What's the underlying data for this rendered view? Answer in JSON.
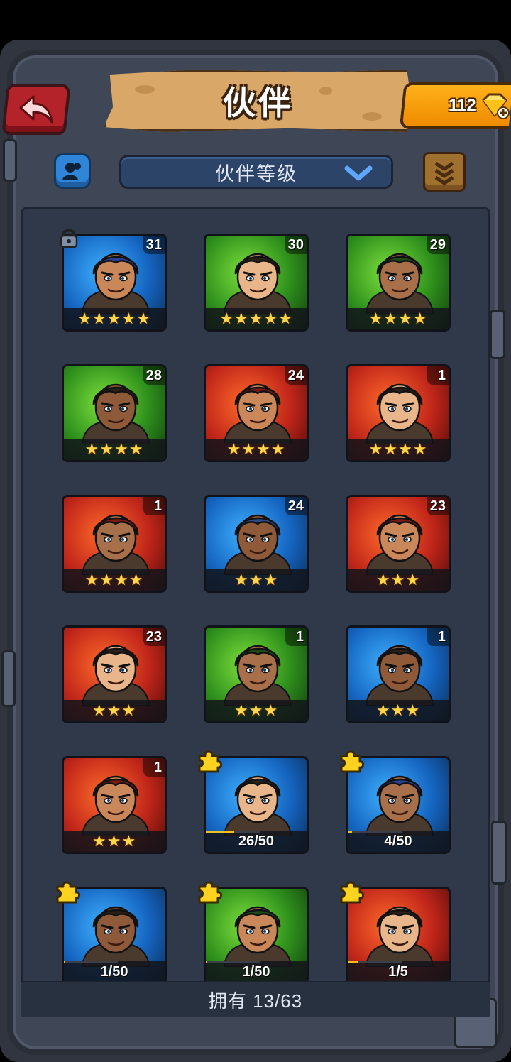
{
  "header": {
    "title": "伙伴",
    "gems": "112"
  },
  "toolbar": {
    "sort_label": "伙伴等级"
  },
  "footer": {
    "owned_label": "拥有 13/63"
  },
  "colors": {
    "blue": "#2a8fe3",
    "green": "#3fa42a",
    "red": "#cf2a1c",
    "gold_star": "#ffd54a"
  },
  "heroes": [
    {
      "level": "31",
      "stars": "★★★★★",
      "glow": "blue",
      "locked": true,
      "icon": "bearded-warrior-portrait"
    },
    {
      "level": "30",
      "stars": "★★★★★",
      "glow": "green",
      "icon": "hooded-elf-portrait"
    },
    {
      "level": "29",
      "stars": "★★★★",
      "glow": "green",
      "icon": "dark-haired-woman-portrait"
    },
    {
      "level": "28",
      "stars": "★★★★",
      "glow": "green",
      "icon": "long-haired-man-portrait"
    },
    {
      "level": "24",
      "stars": "★★★★",
      "glow": "red",
      "icon": "scarecrow-hat-portrait"
    },
    {
      "level": "1",
      "stars": "★★★★",
      "glow": "red",
      "icon": "lizard-red-cap-portrait"
    },
    {
      "level": "1",
      "stars": "★★★★",
      "glow": "red",
      "icon": "afro-headband-woman-portrait"
    },
    {
      "level": "24",
      "stars": "★★★",
      "glow": "blue",
      "icon": "boar-beast-portrait"
    },
    {
      "level": "23",
      "stars": "★★★",
      "glow": "red",
      "icon": "blonde-woman-skull-portrait"
    },
    {
      "level": "23",
      "stars": "★★★",
      "glow": "red",
      "icon": "werewolf-portrait"
    },
    {
      "level": "1",
      "stars": "★★★",
      "glow": "green",
      "icon": "green-haired-man-portrait"
    },
    {
      "level": "1",
      "stars": "★★★",
      "glow": "blue",
      "icon": "blue-lizard-portrait"
    },
    {
      "level": "1",
      "stars": "★★★",
      "glow": "red",
      "icon": "red-beast-portrait"
    },
    {
      "progress": "26/50",
      "fraction": 0.52,
      "glow": "blue",
      "shard": true,
      "icon": "armored-beast-portrait"
    },
    {
      "progress": "4/50",
      "fraction": 0.08,
      "glow": "blue",
      "shard": true,
      "icon": "blue-haired-woman-portrait"
    },
    {
      "progress": "1/50",
      "fraction": 0.02,
      "glow": "blue",
      "shard": true,
      "icon": "long-haired-man-portrait"
    },
    {
      "progress": "1/50",
      "fraction": 0.02,
      "glow": "green",
      "shard": true,
      "icon": "long-haired-man-portrait"
    },
    {
      "progress": "1/5",
      "fraction": 0.2,
      "glow": "red",
      "shard": true,
      "icon": "red-fish-creature-portrait"
    }
  ]
}
